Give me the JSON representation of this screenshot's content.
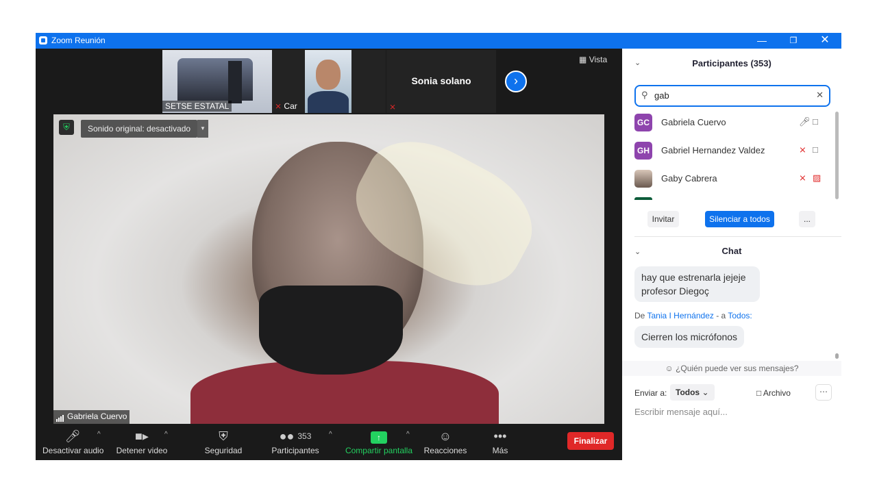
{
  "window": {
    "title": "Zoom Reunión",
    "accent": "#0e72ed"
  },
  "thumbnails": [
    {
      "label": "SETSE ESTATAL"
    },
    {
      "label": "Car"
    },
    {
      "label": "Sonia solano"
    }
  ],
  "view_label": "Vista",
  "main_video": {
    "original_sound": "Sonido original: desactivado",
    "speaker_name": "Gabriela Cuervo"
  },
  "toolbar": {
    "mute": "Desactivar audio",
    "stop_video": "Detener video",
    "security": "Seguridad",
    "participants": "Participantes",
    "participants_count": "353",
    "share": "Compartir pantalla",
    "reactions": "Reacciones",
    "more": "Más",
    "end": "Finalizar"
  },
  "participants_panel": {
    "title": "Participantes (353)",
    "search_value": "gab",
    "items": [
      {
        "initials": "GC",
        "name": "Gabriela Cuervo",
        "color": "#8e44ad",
        "mic": "on",
        "cam": "on"
      },
      {
        "initials": "GH",
        "name": "Gabriel Hernandez Valdez",
        "color": "#8e44ad",
        "mic": "off",
        "cam": "on"
      },
      {
        "initials": "",
        "name": "Gaby Cabrera",
        "color": "#6b5a50",
        "mic": "off",
        "cam": "off"
      }
    ],
    "invite": "Invitar",
    "mute_all": "Silenciar a todos",
    "more": "..."
  },
  "chat": {
    "title": "Chat",
    "messages": [
      {
        "text": "hay que estrenarla jejeje profesor Diegoç"
      },
      {
        "from_prefix": "De",
        "from": "Tania I Hernández",
        "separator": "- a",
        "to": "Todos:",
        "text": "Cierren los micrófonos"
      }
    ],
    "who_can_see": "¿Quién puede ver sus mensajes?",
    "send_to_label": "Enviar a:",
    "send_to_value": "Todos",
    "file_label": "Archivo",
    "input_placeholder": "Escribir mensaje aquí..."
  }
}
